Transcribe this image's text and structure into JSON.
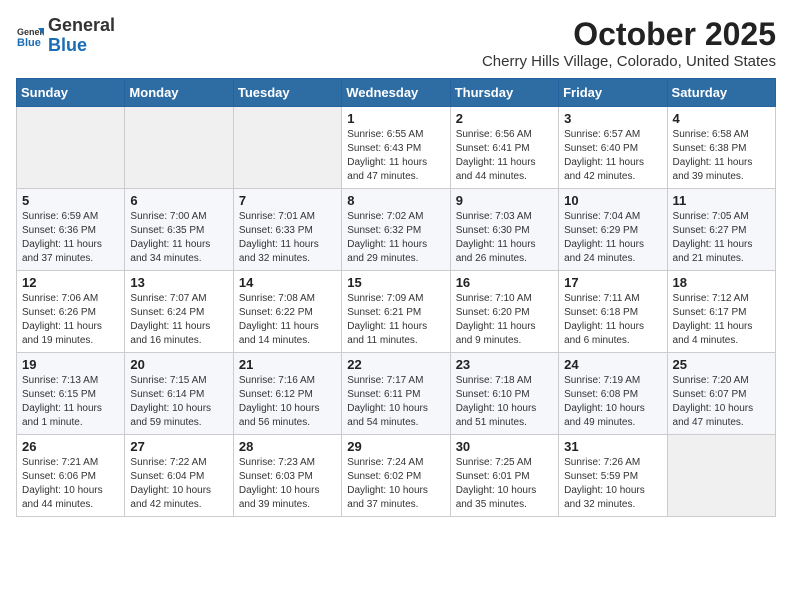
{
  "header": {
    "logo_line1": "General",
    "logo_line2": "Blue",
    "month_title": "October 2025",
    "location": "Cherry Hills Village, Colorado, United States"
  },
  "weekdays": [
    "Sunday",
    "Monday",
    "Tuesday",
    "Wednesday",
    "Thursday",
    "Friday",
    "Saturday"
  ],
  "weeks": [
    [
      {
        "day": "",
        "info": ""
      },
      {
        "day": "",
        "info": ""
      },
      {
        "day": "",
        "info": ""
      },
      {
        "day": "1",
        "info": "Sunrise: 6:55 AM\nSunset: 6:43 PM\nDaylight: 11 hours\nand 47 minutes."
      },
      {
        "day": "2",
        "info": "Sunrise: 6:56 AM\nSunset: 6:41 PM\nDaylight: 11 hours\nand 44 minutes."
      },
      {
        "day": "3",
        "info": "Sunrise: 6:57 AM\nSunset: 6:40 PM\nDaylight: 11 hours\nand 42 minutes."
      },
      {
        "day": "4",
        "info": "Sunrise: 6:58 AM\nSunset: 6:38 PM\nDaylight: 11 hours\nand 39 minutes."
      }
    ],
    [
      {
        "day": "5",
        "info": "Sunrise: 6:59 AM\nSunset: 6:36 PM\nDaylight: 11 hours\nand 37 minutes."
      },
      {
        "day": "6",
        "info": "Sunrise: 7:00 AM\nSunset: 6:35 PM\nDaylight: 11 hours\nand 34 minutes."
      },
      {
        "day": "7",
        "info": "Sunrise: 7:01 AM\nSunset: 6:33 PM\nDaylight: 11 hours\nand 32 minutes."
      },
      {
        "day": "8",
        "info": "Sunrise: 7:02 AM\nSunset: 6:32 PM\nDaylight: 11 hours\nand 29 minutes."
      },
      {
        "day": "9",
        "info": "Sunrise: 7:03 AM\nSunset: 6:30 PM\nDaylight: 11 hours\nand 26 minutes."
      },
      {
        "day": "10",
        "info": "Sunrise: 7:04 AM\nSunset: 6:29 PM\nDaylight: 11 hours\nand 24 minutes."
      },
      {
        "day": "11",
        "info": "Sunrise: 7:05 AM\nSunset: 6:27 PM\nDaylight: 11 hours\nand 21 minutes."
      }
    ],
    [
      {
        "day": "12",
        "info": "Sunrise: 7:06 AM\nSunset: 6:26 PM\nDaylight: 11 hours\nand 19 minutes."
      },
      {
        "day": "13",
        "info": "Sunrise: 7:07 AM\nSunset: 6:24 PM\nDaylight: 11 hours\nand 16 minutes."
      },
      {
        "day": "14",
        "info": "Sunrise: 7:08 AM\nSunset: 6:22 PM\nDaylight: 11 hours\nand 14 minutes."
      },
      {
        "day": "15",
        "info": "Sunrise: 7:09 AM\nSunset: 6:21 PM\nDaylight: 11 hours\nand 11 minutes."
      },
      {
        "day": "16",
        "info": "Sunrise: 7:10 AM\nSunset: 6:20 PM\nDaylight: 11 hours\nand 9 minutes."
      },
      {
        "day": "17",
        "info": "Sunrise: 7:11 AM\nSunset: 6:18 PM\nDaylight: 11 hours\nand 6 minutes."
      },
      {
        "day": "18",
        "info": "Sunrise: 7:12 AM\nSunset: 6:17 PM\nDaylight: 11 hours\nand 4 minutes."
      }
    ],
    [
      {
        "day": "19",
        "info": "Sunrise: 7:13 AM\nSunset: 6:15 PM\nDaylight: 11 hours\nand 1 minute."
      },
      {
        "day": "20",
        "info": "Sunrise: 7:15 AM\nSunset: 6:14 PM\nDaylight: 10 hours\nand 59 minutes."
      },
      {
        "day": "21",
        "info": "Sunrise: 7:16 AM\nSunset: 6:12 PM\nDaylight: 10 hours\nand 56 minutes."
      },
      {
        "day": "22",
        "info": "Sunrise: 7:17 AM\nSunset: 6:11 PM\nDaylight: 10 hours\nand 54 minutes."
      },
      {
        "day": "23",
        "info": "Sunrise: 7:18 AM\nSunset: 6:10 PM\nDaylight: 10 hours\nand 51 minutes."
      },
      {
        "day": "24",
        "info": "Sunrise: 7:19 AM\nSunset: 6:08 PM\nDaylight: 10 hours\nand 49 minutes."
      },
      {
        "day": "25",
        "info": "Sunrise: 7:20 AM\nSunset: 6:07 PM\nDaylight: 10 hours\nand 47 minutes."
      }
    ],
    [
      {
        "day": "26",
        "info": "Sunrise: 7:21 AM\nSunset: 6:06 PM\nDaylight: 10 hours\nand 44 minutes."
      },
      {
        "day": "27",
        "info": "Sunrise: 7:22 AM\nSunset: 6:04 PM\nDaylight: 10 hours\nand 42 minutes."
      },
      {
        "day": "28",
        "info": "Sunrise: 7:23 AM\nSunset: 6:03 PM\nDaylight: 10 hours\nand 39 minutes."
      },
      {
        "day": "29",
        "info": "Sunrise: 7:24 AM\nSunset: 6:02 PM\nDaylight: 10 hours\nand 37 minutes."
      },
      {
        "day": "30",
        "info": "Sunrise: 7:25 AM\nSunset: 6:01 PM\nDaylight: 10 hours\nand 35 minutes."
      },
      {
        "day": "31",
        "info": "Sunrise: 7:26 AM\nSunset: 5:59 PM\nDaylight: 10 hours\nand 32 minutes."
      },
      {
        "day": "",
        "info": ""
      }
    ]
  ]
}
